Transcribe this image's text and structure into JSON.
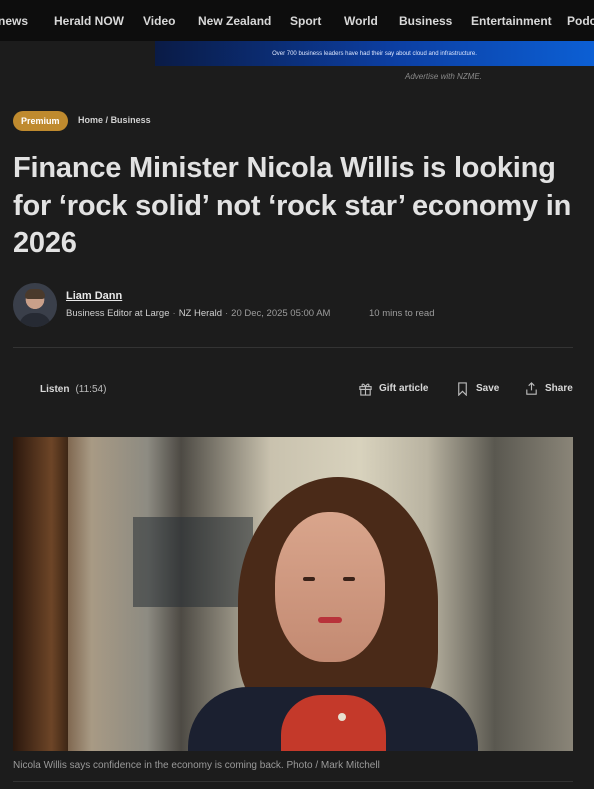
{
  "nav": {
    "items": [
      "news",
      "Herald NOW",
      "Video",
      "New Zealand",
      "Sport",
      "World",
      "Business",
      "Entertainment",
      "Podc"
    ]
  },
  "ad": {
    "text": "Over 700 business leaders have had their say about cloud and infrastructure.",
    "note": "Advertise with NZME."
  },
  "article": {
    "badge": "Premium",
    "breadcrumb": {
      "home": "Home",
      "sep": "/",
      "section": "Business"
    },
    "headline": "Finance Minister Nicola Willis is looking for ‘rock solid’ not ‘rock star’ economy in 2026",
    "author": {
      "name": "Liam Dann",
      "role": "Business Editor at Large",
      "outlet": "NZ Herald",
      "date": "20 Dec, 2025 05:00 AM",
      "read_time": "10 mins to read"
    },
    "actions": {
      "listen": "Listen",
      "listen_duration": "(11:54)",
      "gift": "Gift article",
      "save": "Save",
      "share": "Share"
    },
    "image_caption": "Nicola Willis says confidence in the economy is coming back. Photo / Mark Mitchell"
  },
  "colors": {
    "badge": "#bf8a2e",
    "background": "#1c1c1c",
    "nav": "#0d0d0d"
  }
}
